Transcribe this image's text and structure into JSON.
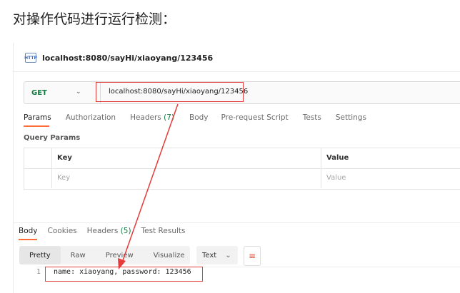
{
  "heading": "对操作代码进行运行检测：",
  "request": {
    "icon": "HTTP",
    "title": "localhost:8080/sayHi/xiaoyang/123456",
    "method": "GET",
    "url": "localhost:8080/sayHi/xiaoyang/123456"
  },
  "tabs": {
    "params": "Params",
    "authorization": "Authorization",
    "headers": "Headers",
    "headers_count": "(7)",
    "body": "Body",
    "prerequest": "Pre-request Script",
    "tests": "Tests",
    "settings": "Settings"
  },
  "query_params": {
    "label": "Query Params",
    "columns": [
      "Key",
      "Value"
    ],
    "placeholder_key": "Key",
    "placeholder_value": "Value"
  },
  "response": {
    "tabs": {
      "body": "Body",
      "cookies": "Cookies",
      "headers": "Headers",
      "headers_count": "(5)",
      "test_results": "Test Results"
    },
    "view_modes": [
      "Pretty",
      "Raw",
      "Preview",
      "Visualize"
    ],
    "active_view": "Pretty",
    "format": "Text",
    "line_number": "1",
    "line_text": "name: xiaoyang, password: 123456"
  },
  "colors": {
    "accent": "#ff6c37",
    "annotation": "#e43b3b",
    "method_get": "#0f7b3f"
  },
  "icons": [
    "http-icon",
    "chevron-down-icon",
    "wrap-lines-icon"
  ]
}
